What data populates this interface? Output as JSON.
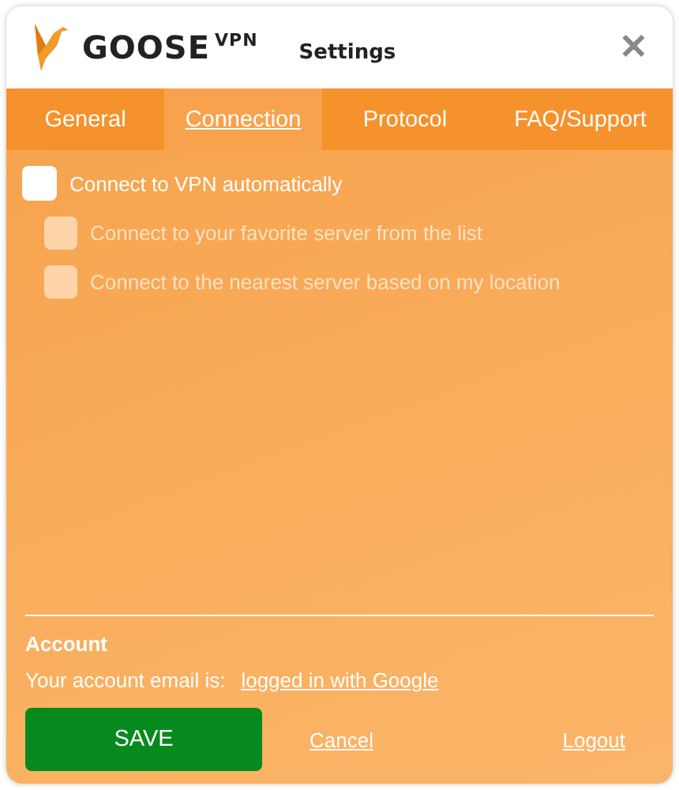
{
  "header": {
    "brand": "GOOSE",
    "brand_sup": "VPN",
    "title": "Settings",
    "close": "✕"
  },
  "tabs": [
    {
      "label": "General",
      "selected": false
    },
    {
      "label": "Connection",
      "selected": true
    },
    {
      "label": "Protocol",
      "selected": false
    },
    {
      "label": "FAQ/Support",
      "selected": false
    }
  ],
  "options": [
    {
      "label": "Connect to VPN automatically",
      "checked": false,
      "disabled": false,
      "children": [
        {
          "label": "Connect to your favorite server from the list",
          "checked": false,
          "disabled": true
        },
        {
          "label": "Connect to the nearest server based on my location",
          "checked": false,
          "disabled": true
        }
      ]
    }
  ],
  "account": {
    "heading": "Account",
    "email_label": "Your account email is:",
    "email_link": "logged in with Google"
  },
  "actions": {
    "save": "SAVE",
    "cancel": "Cancel",
    "logout": "Logout"
  }
}
